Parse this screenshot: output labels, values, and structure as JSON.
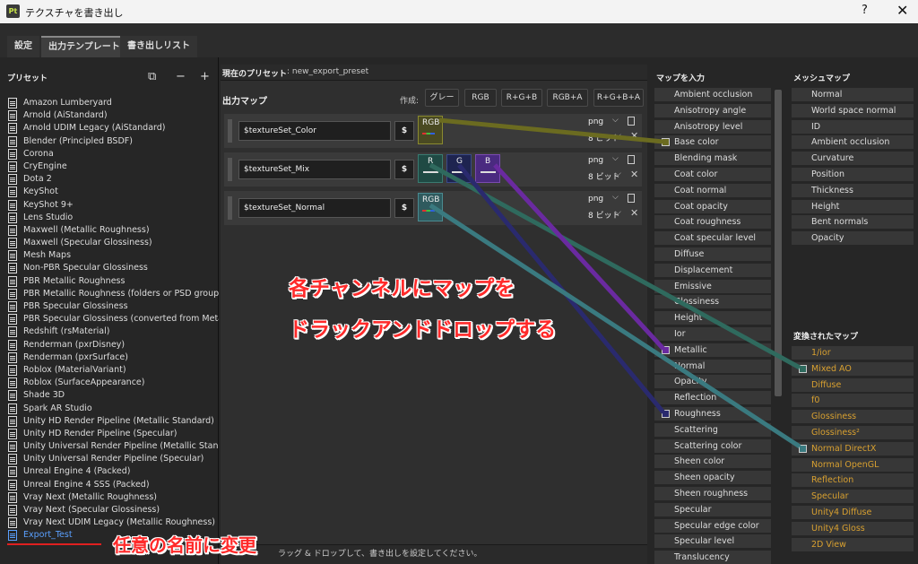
{
  "window": {
    "title": "テクスチャを書き出し",
    "app_icon": "Pt",
    "help": "?",
    "close": "✕"
  },
  "tabs": [
    {
      "label": "設定"
    },
    {
      "label": "出力テンプレート"
    },
    {
      "label": "書き出しリスト"
    }
  ],
  "presets": {
    "title": "プリセット",
    "items": [
      "Amazon Lumberyard",
      "Arnold (AiStandard)",
      "Arnold UDIM Legacy (AiStandard)",
      "Blender (Principled BSDF)",
      "Corona",
      "CryEngine",
      "Dota 2",
      "KeyShot",
      "KeyShot 9+",
      "Lens Studio",
      "Maxwell (Metallic Roughness)",
      "Maxwell (Specular Glossiness)",
      "Mesh Maps",
      "Non-PBR Specular Glossiness",
      "PBR Metallic Roughness",
      "PBR Metallic Roughness (folders or PSD groups)",
      "PBR Specular Glossiness",
      "PBR Specular Glossiness (converted from Meta...",
      "Redshift (rsMaterial)",
      "Renderman (pxrDisney)",
      "Renderman (pxrSurface)",
      "Roblox (MaterialVariant)",
      "Roblox (SurfaceAppearance)",
      "Shade 3D",
      "Spark AR Studio",
      "Unity HD Render Pipeline (Metallic Standard)",
      "Unity HD Render Pipeline (Specular)",
      "Unity Universal Render Pipeline (Metallic Stan...",
      "Unity Universal Render Pipeline (Specular)",
      "Unreal Engine 4 (Packed)",
      "Unreal Engine 4 SSS (Packed)",
      "Vray Next (Metallic Roughness)",
      "Vray Next (Specular Glossiness)",
      "Vray Next UDIM Legacy (Metallic Roughness)",
      "Export_Test"
    ],
    "tools": {
      "copy": "⧉",
      "minus": "−",
      "plus": "+"
    }
  },
  "center": {
    "current_preset_label": "現在のプリセット",
    "current_preset_value": ": new_export_preset",
    "output_map_title": "出力マップ",
    "create_label": "作成:",
    "modes": [
      "グレー",
      "RGB",
      "R+G+B",
      "RGB+A",
      "R+G+B+A"
    ],
    "rows": [
      {
        "name": "$textureSet_Color",
        "dollar": "$",
        "channels": [
          {
            "label": "RGB"
          }
        ],
        "format": "png",
        "bitdepth": "8 ビット"
      },
      {
        "name": "$textureSet_Mix",
        "dollar": "$",
        "channels": [
          {
            "label": "R"
          },
          {
            "label": "G"
          },
          {
            "label": "B"
          }
        ],
        "format": "png",
        "bitdepth": "8 ビット"
      },
      {
        "name": "$textureSet_Normal",
        "dollar": "$",
        "channels": [
          {
            "label": "RGB"
          }
        ],
        "format": "png",
        "bitdepth": "8 ビット"
      }
    ],
    "footer_text": "ラッグ & ドロップして、書き出しを設定してください。"
  },
  "input_maps": {
    "title": "マップを入力",
    "items": [
      "Ambient occlusion",
      "Anisotropy angle",
      "Anisotropy level",
      "Base color",
      "Blending mask",
      "Coat color",
      "Coat normal",
      "Coat opacity",
      "Coat roughness",
      "Coat specular level",
      "Diffuse",
      "Displacement",
      "Emissive",
      "Glossiness",
      "Height",
      "Ior",
      "Metallic",
      "Normal",
      "Opacity",
      "Reflection",
      "Roughness",
      "Scattering",
      "Scattering color",
      "Sheen color",
      "Sheen opacity",
      "Sheen roughness",
      "Specular",
      "Specular edge color",
      "Specular level",
      "Translucency"
    ]
  },
  "mesh_maps": {
    "title": "メッシュマップ",
    "items": [
      "Normal",
      "World space normal",
      "ID",
      "Ambient occlusion",
      "Curvature",
      "Position",
      "Thickness",
      "Height",
      "Bent normals",
      "Opacity"
    ]
  },
  "converted_maps": {
    "title": "変換されたマップ",
    "items": [
      "1/ior",
      "Mixed AO",
      "Diffuse",
      "f0",
      "Glossiness",
      "Glossiness²",
      "Normal DirectX",
      "Normal OpenGL",
      "Reflection",
      "Specular",
      "Unity4 Diffuse",
      "Unity4 Gloss",
      "2D View"
    ]
  },
  "annotations": {
    "line1": "各チャンネルにマップを",
    "line2": "ドラックアンドドロップする",
    "rename": "任意の名前に変更"
  },
  "colors": {
    "base_color_wire": "#6b6b20",
    "green_wire": "#2f6a5e",
    "purple_wire": "#6a2aa0",
    "navy_wire": "#2a2a6e",
    "normal_wire": "#3a7a80",
    "accent_blue": "#5aa0ff",
    "annotation_red": "#ff2a2a",
    "converted_orange": "#d8a030"
  }
}
